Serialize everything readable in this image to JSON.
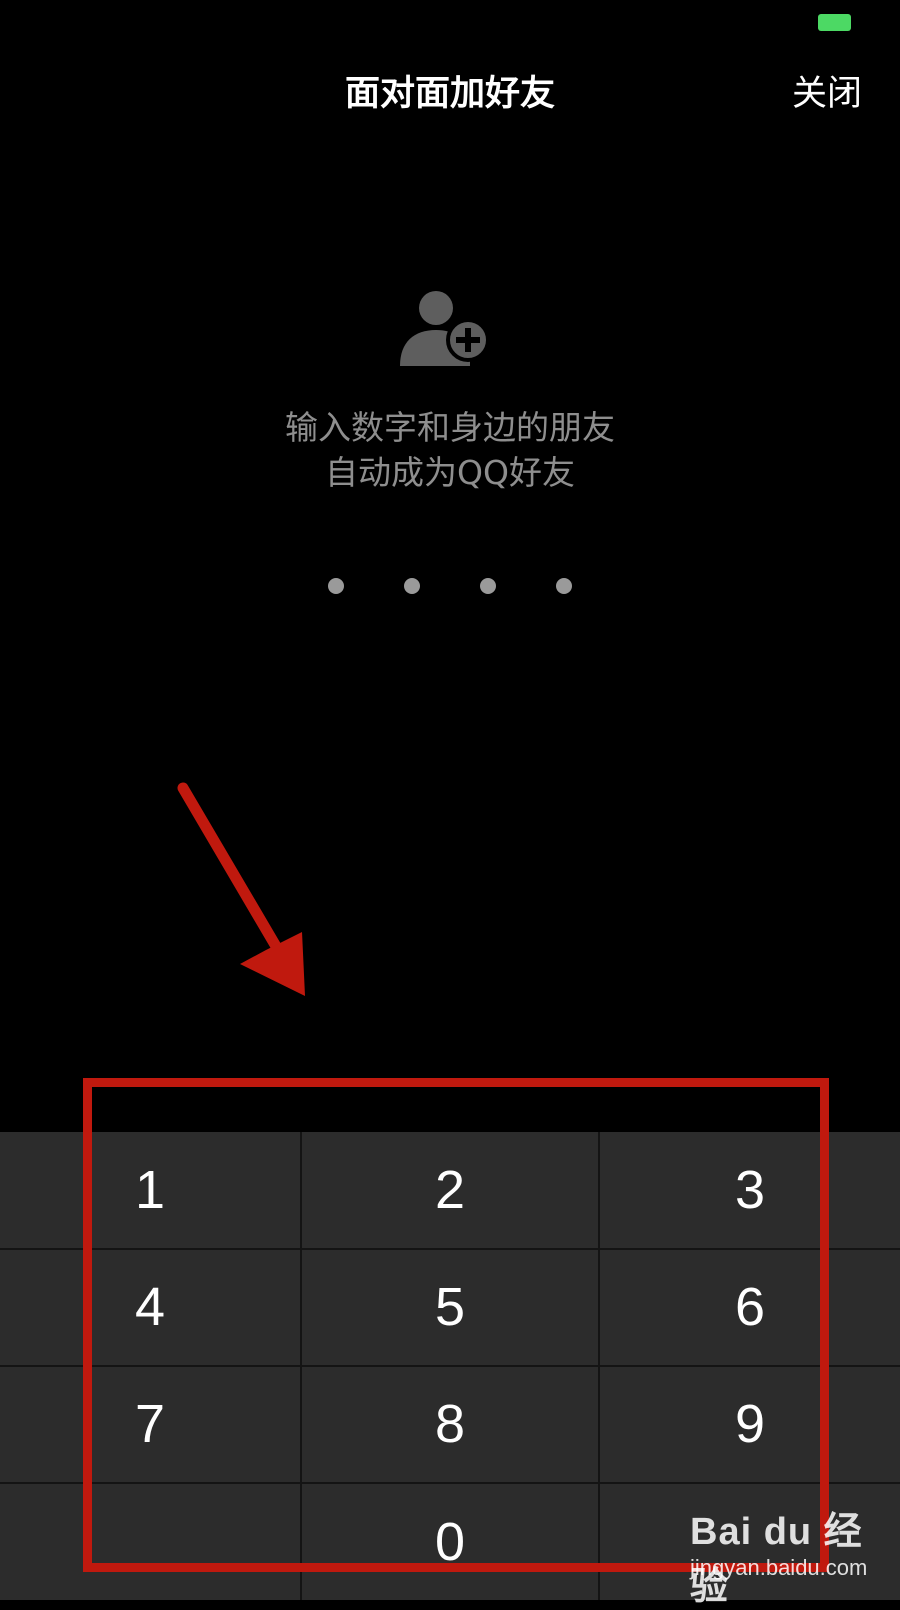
{
  "header": {
    "title": "面对面加好友",
    "close_label": "关闭"
  },
  "hint": {
    "line1": "输入数字和身边的朋友",
    "line2": "自动成为QQ好友"
  },
  "code_dots_count": 4,
  "keypad": {
    "keys": [
      "1",
      "2",
      "3",
      "4",
      "5",
      "6",
      "7",
      "8",
      "9",
      "",
      "0",
      ""
    ]
  },
  "watermark": {
    "main": "Bai du 经验",
    "sub": "jingyan.baidu.com"
  },
  "colors": {
    "background": "#000000",
    "keypad_bg": "#2c2c2c",
    "annotation": "#c0190e",
    "battery": "#4cd964"
  },
  "icons": {
    "add_friend": "person-plus-icon",
    "battery": "battery-icon",
    "annotation_arrow": "arrow-icon"
  }
}
